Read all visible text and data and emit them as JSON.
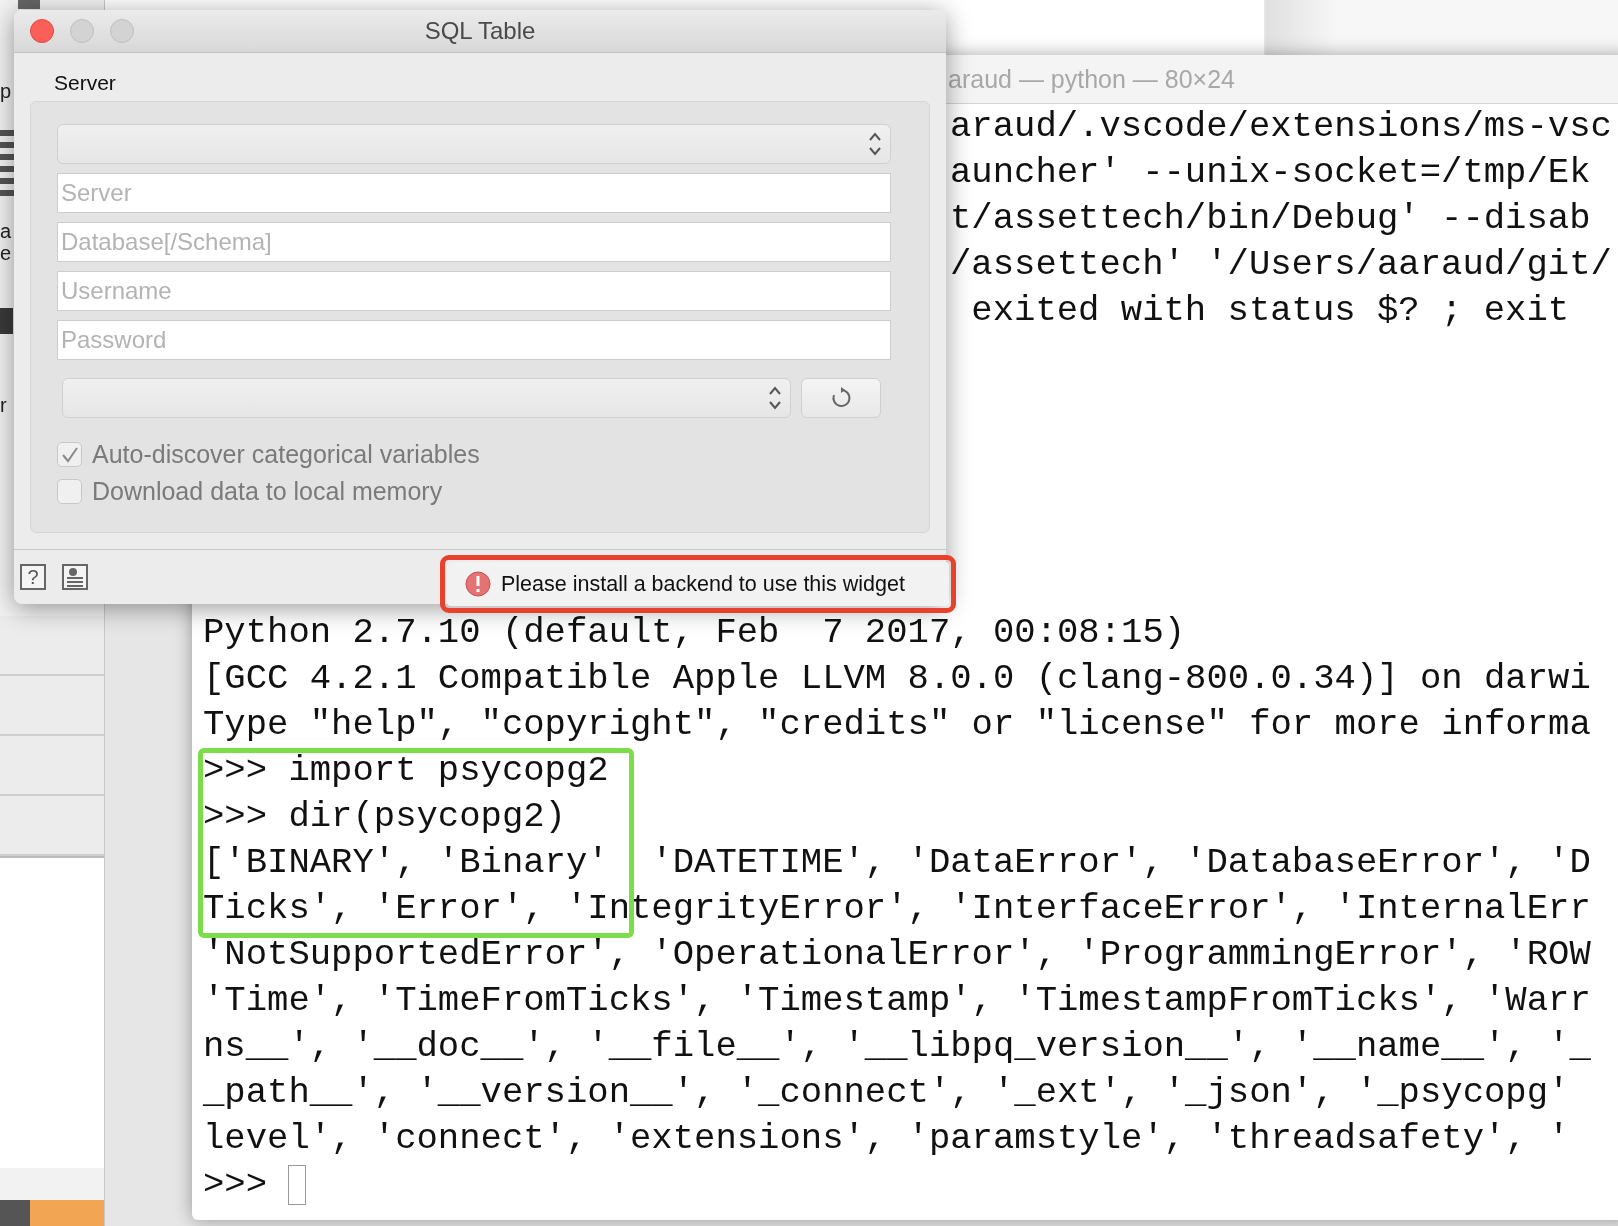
{
  "left_window": {
    "fragments": [
      "p",
      "a",
      "e",
      "r"
    ]
  },
  "terminal": {
    "title": "araud — python — 80×24",
    "top_lines": [
      "araud/.vscode/extensions/ms-vsc",
      "auncher' --unix-socket=/tmp/Ek",
      "t/assettech/bin/Debug' --disab",
      "/assettech' '/Users/aaraud/git/",
      " exited with status $? ; exit"
    ],
    "lines": [
      "Python 2.7.10 (default, Feb  7 2017, 00:08:15)",
      "[GCC 4.2.1 Compatible Apple LLVM 8.0.0 (clang-800.0.34)] on darwi",
      "Type \"help\", \"copyright\", \"credits\" or \"license\" for more informa",
      ">>> import psycopg2",
      ">>> dir(psycopg2)",
      "['BINARY', 'Binary'  'DATETIME', 'DataError', 'DatabaseError', 'D",
      "Ticks', 'Error', 'IntegrityError', 'InterfaceError', 'InternalErr",
      "'NotSupportedError', 'OperationalError', 'ProgrammingError', 'ROW",
      "'Time', 'TimeFromTicks', 'Timestamp', 'TimestampFromTicks', 'Warr",
      "ns__', '__doc__', '__file__', '__libpq_version__', '__name__', '_",
      "_path__', '__version__', '_connect', '_ext', '_json', '_psycopg'",
      "level', 'connect', 'extensions', 'paramstyle', 'threadsafety', '",
      ">>> "
    ]
  },
  "dialog": {
    "title": "SQL Table",
    "section_label": "Server",
    "fields": [
      {
        "placeholder": "Server"
      },
      {
        "placeholder": "Database[/Schema]"
      },
      {
        "placeholder": "Username"
      },
      {
        "placeholder": "Password"
      }
    ],
    "checkboxes": [
      {
        "label": "Auto-discover categorical variables",
        "checked": true
      },
      {
        "label": "Download data to local memory",
        "checked": false
      }
    ],
    "help_button": "?",
    "message": "Please install a backend to use this widget"
  }
}
